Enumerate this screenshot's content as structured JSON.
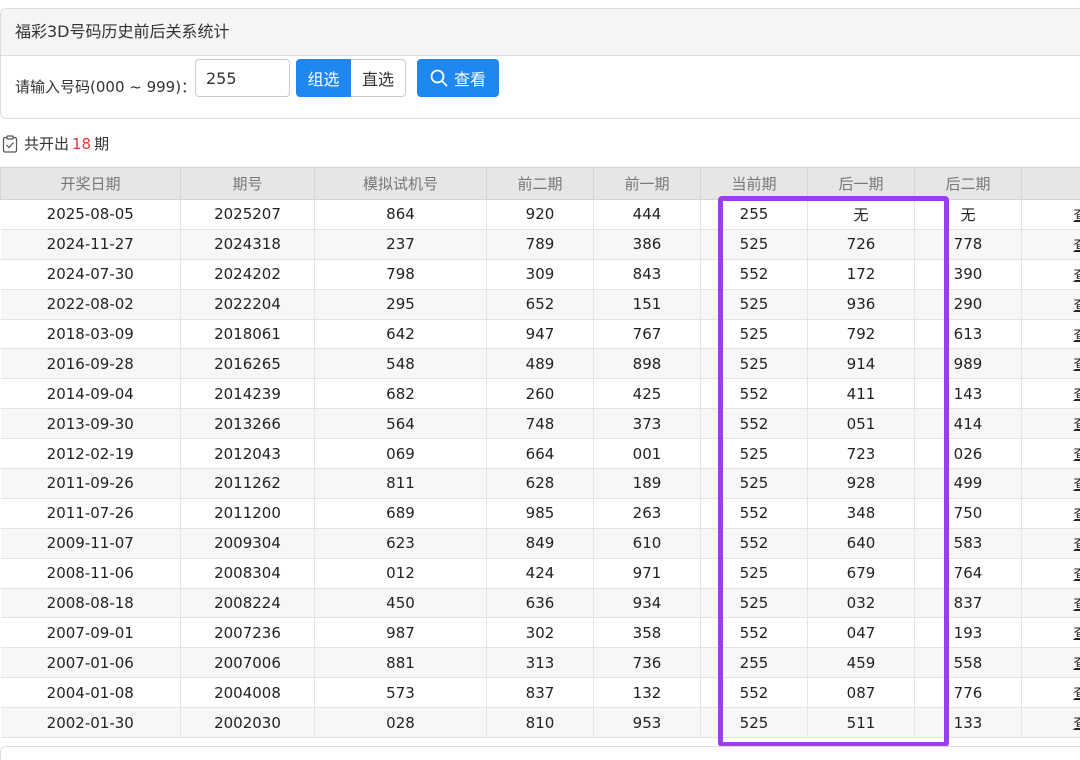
{
  "panel": {
    "title": "福彩3D号码历史前后关系统计",
    "input_label": "请输入号码(000 ~ 999)：",
    "input_value": "255",
    "mode_group": "组选",
    "mode_direct": "直选",
    "view_button": "查看"
  },
  "summary": {
    "prefix": "共开出",
    "count": "18",
    "suffix": "期"
  },
  "table": {
    "headers": [
      "开奖日期",
      "期号",
      "模拟试机号",
      "前二期",
      "前一期",
      "当前期",
      "后一期",
      "后二期",
      ""
    ],
    "action_label": "查",
    "rows": [
      [
        "2025-08-05",
        "2025207",
        "864",
        "920",
        "444",
        "255",
        "无",
        "无"
      ],
      [
        "2024-11-27",
        "2024318",
        "237",
        "789",
        "386",
        "525",
        "726",
        "778"
      ],
      [
        "2024-07-30",
        "2024202",
        "798",
        "309",
        "843",
        "552",
        "172",
        "390"
      ],
      [
        "2022-08-02",
        "2022204",
        "295",
        "652",
        "151",
        "525",
        "936",
        "290"
      ],
      [
        "2018-03-09",
        "2018061",
        "642",
        "947",
        "767",
        "525",
        "792",
        "613"
      ],
      [
        "2016-09-28",
        "2016265",
        "548",
        "489",
        "898",
        "525",
        "914",
        "989"
      ],
      [
        "2014-09-04",
        "2014239",
        "682",
        "260",
        "425",
        "552",
        "411",
        "143"
      ],
      [
        "2013-09-30",
        "2013266",
        "564",
        "748",
        "373",
        "552",
        "051",
        "414"
      ],
      [
        "2012-02-19",
        "2012043",
        "069",
        "664",
        "001",
        "525",
        "723",
        "026"
      ],
      [
        "2011-09-26",
        "2011262",
        "811",
        "628",
        "189",
        "525",
        "928",
        "499"
      ],
      [
        "2011-07-26",
        "2011200",
        "689",
        "985",
        "263",
        "552",
        "348",
        "750"
      ],
      [
        "2009-11-07",
        "2009304",
        "623",
        "849",
        "610",
        "552",
        "640",
        "583"
      ],
      [
        "2008-11-06",
        "2008304",
        "012",
        "424",
        "971",
        "525",
        "679",
        "764"
      ],
      [
        "2008-08-18",
        "2008224",
        "450",
        "636",
        "934",
        "525",
        "032",
        "837"
      ],
      [
        "2007-09-01",
        "2007236",
        "987",
        "302",
        "358",
        "552",
        "047",
        "193"
      ],
      [
        "2007-01-06",
        "2007006",
        "881",
        "313",
        "736",
        "255",
        "459",
        "558"
      ],
      [
        "2004-01-08",
        "2004008",
        "573",
        "837",
        "132",
        "552",
        "087",
        "776"
      ],
      [
        "2002-01-30",
        "2002030",
        "028",
        "810",
        "953",
        "525",
        "511",
        "133"
      ]
    ]
  },
  "colors": {
    "accent": "#1e87f0",
    "highlight": "#9b3ef0",
    "count": "#e4393c"
  }
}
